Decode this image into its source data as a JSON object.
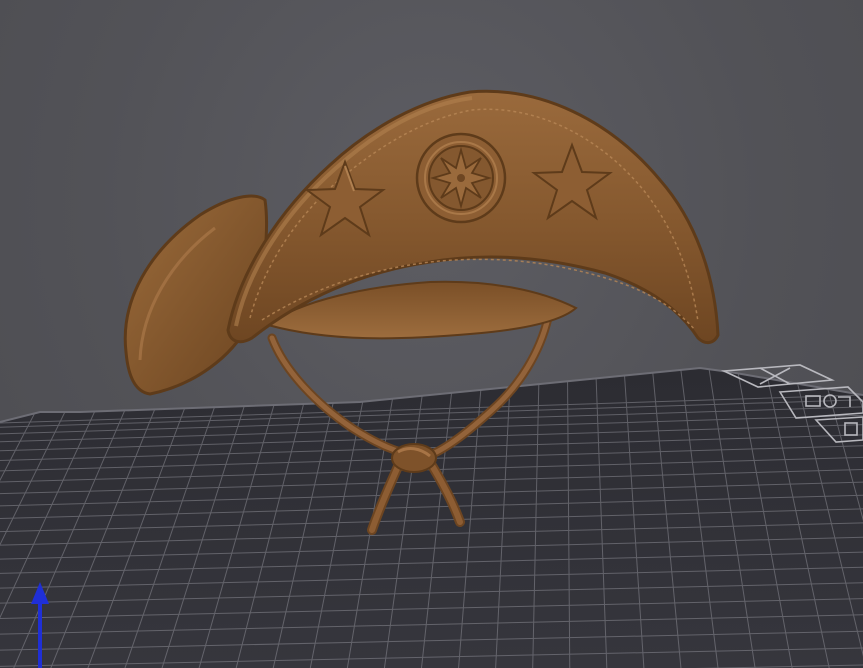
{
  "viewport": {
    "background_color": "#545459",
    "bed_color": "#2f2f35",
    "grid_color": "#8a8a92",
    "model_color": "#8a5a2e",
    "axis_color": "#1f2fd6"
  },
  "scene": {
    "model": "hat",
    "bed_corner_icons": [
      "close-x-icon",
      "object-settings-icon",
      "bed-label-icon"
    ],
    "axis_indicator": "z-axis-arrow"
  }
}
